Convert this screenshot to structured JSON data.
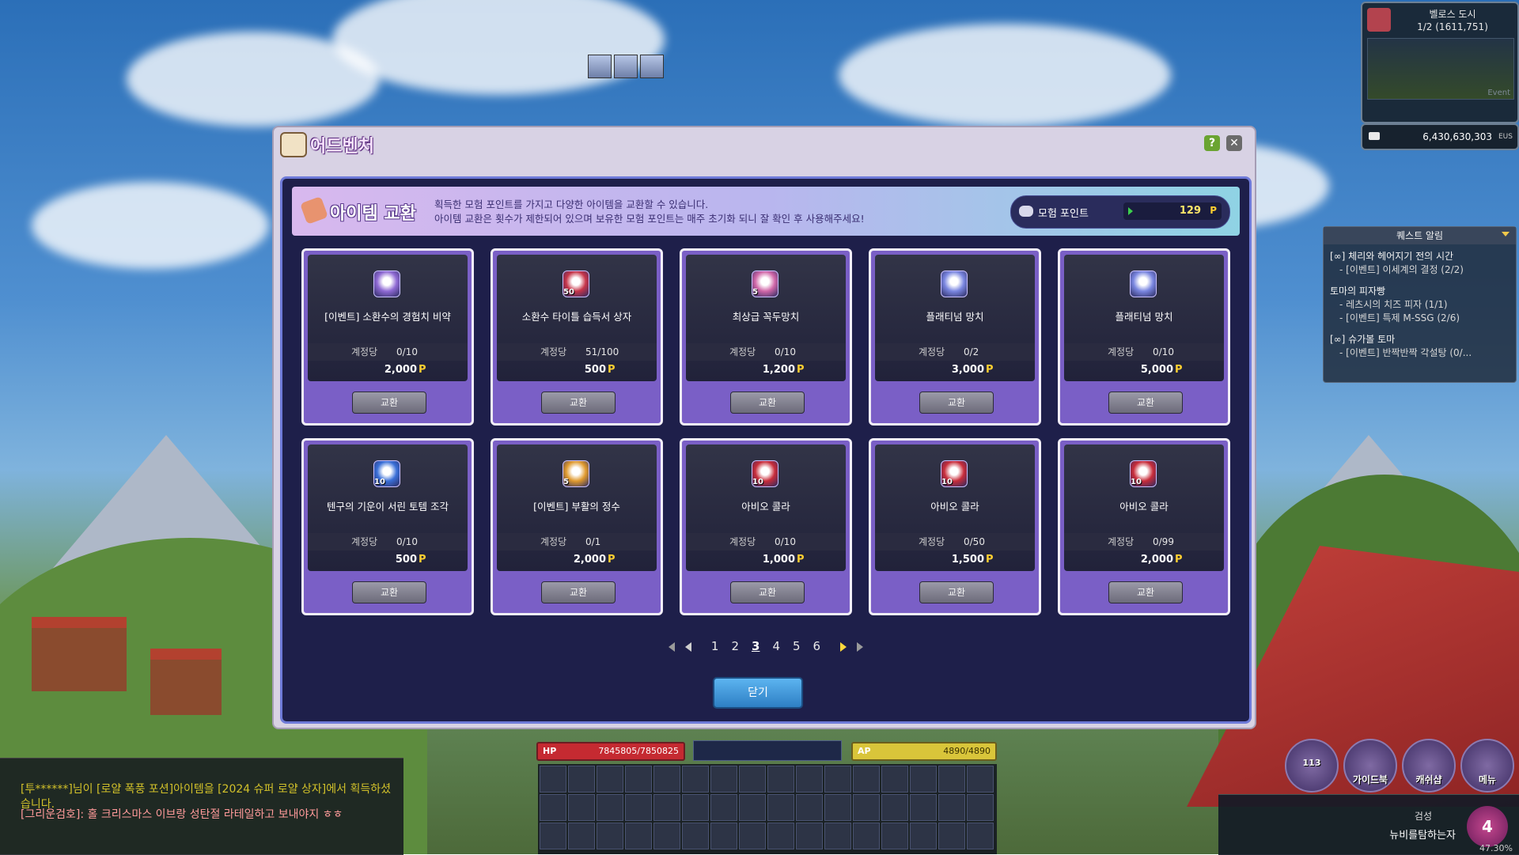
{
  "party": {
    "portraits": [
      "party-member-1",
      "party-member-2",
      "party-member-3"
    ]
  },
  "minimap": {
    "map_name": "벨로스 도시",
    "channel_pos": "1/2 (1611,751)",
    "tag": "Event"
  },
  "meso": {
    "amount": "6,430,630,303",
    "unit": "EUS"
  },
  "quest_alert": {
    "title": "퀘스트 알림",
    "items": [
      {
        "title": "[∞] 체리와 헤어지기 전의 시간",
        "sub": [
          "- [이벤트] 이세계의 결정 (2/2)"
        ]
      },
      {
        "title": "토마의 피자빵",
        "sub": [
          "- 레츠시의 치즈 피자 (1/1)",
          "- [이벤트] 특제 M-SSG (2/6)"
        ]
      },
      {
        "title": "[∞] 슈가볼 토마",
        "sub": [
          "- [이벤트] 반짝반짝 각설탕 (0/..."
        ]
      }
    ]
  },
  "dialog": {
    "window_title": "어드벤처",
    "banner_title": "아이템 교환",
    "banner_desc_1": "획득한 모험 포인트를 가지고 다양한 아이템을 교환할 수 있습니다.",
    "banner_desc_2": "아이템 교환은 횟수가 제한되어 있으며 보유한 모험 포인트는 매주 초기화 되니 잘 확인 후 사용해주세요!",
    "points_label": "모험 포인트",
    "points_value": "129",
    "points_unit": "P",
    "limit_label": "계정당",
    "exchange_label": "교환",
    "price_unit": "P",
    "close_label": "닫기",
    "items": [
      {
        "name": "[이벤트] 소환수의 경험치 비약",
        "limit": "0/10",
        "price": "2,000",
        "qty": "",
        "color": "#8f6ad4"
      },
      {
        "name": "소환수 타이틀 습득서 상자",
        "limit": "51/100",
        "price": "500",
        "qty": "50",
        "color": "#c7354a"
      },
      {
        "name": "최상급 꼭두망치",
        "limit": "0/10",
        "price": "1,200",
        "qty": "5",
        "color": "#d067a8"
      },
      {
        "name": "플래티넘 망치",
        "limit": "0/2",
        "price": "3,000",
        "qty": "",
        "color": "#7a86e0"
      },
      {
        "name": "플래티넘 망치",
        "limit": "0/10",
        "price": "5,000",
        "qty": "",
        "color": "#7a86e0"
      },
      {
        "name": "텐구의 기운이 서린 토템 조각",
        "limit": "0/10",
        "price": "500",
        "qty": "10",
        "color": "#3a6fd8"
      },
      {
        "name": "[이벤트] 부활의 정수",
        "limit": "0/1",
        "price": "2,000",
        "qty": "5",
        "color": "#e09a2e"
      },
      {
        "name": "아비오 콜라",
        "limit": "0/10",
        "price": "1,000",
        "qty": "10",
        "color": "#c82c3a"
      },
      {
        "name": "아비오 콜라",
        "limit": "0/50",
        "price": "1,500",
        "qty": "10",
        "color": "#c82c3a"
      },
      {
        "name": "아비오 콜라",
        "limit": "0/99",
        "price": "2,000",
        "qty": "10",
        "color": "#c82c3a"
      }
    ],
    "pages": [
      "1",
      "2",
      "3",
      "4",
      "5",
      "6"
    ],
    "current_page": "3"
  },
  "chat": {
    "line1": "[투******]님이 [로얄 폭풍 포션]아이템을 [2024 슈퍼 로얄 상자]에서 획득하셨습니다.",
    "line2": "[그리운검호]: 홀 크리스마스 이브랑 성탄절 라테일하고 보내야지 ㅎㅎ"
  },
  "status": {
    "hp_label": "HP",
    "hp_value": "7845805/7850825",
    "ap_label": "AP",
    "ap_value": "4890/4890"
  },
  "menu": {
    "level_ring": "113",
    "guide": "가이드북",
    "cash": "캐쉬샵",
    "menu": "메뉴"
  },
  "character": {
    "job": "검성",
    "name": "뉴비를탐하는자",
    "exp": "47.30%",
    "level": "4"
  }
}
